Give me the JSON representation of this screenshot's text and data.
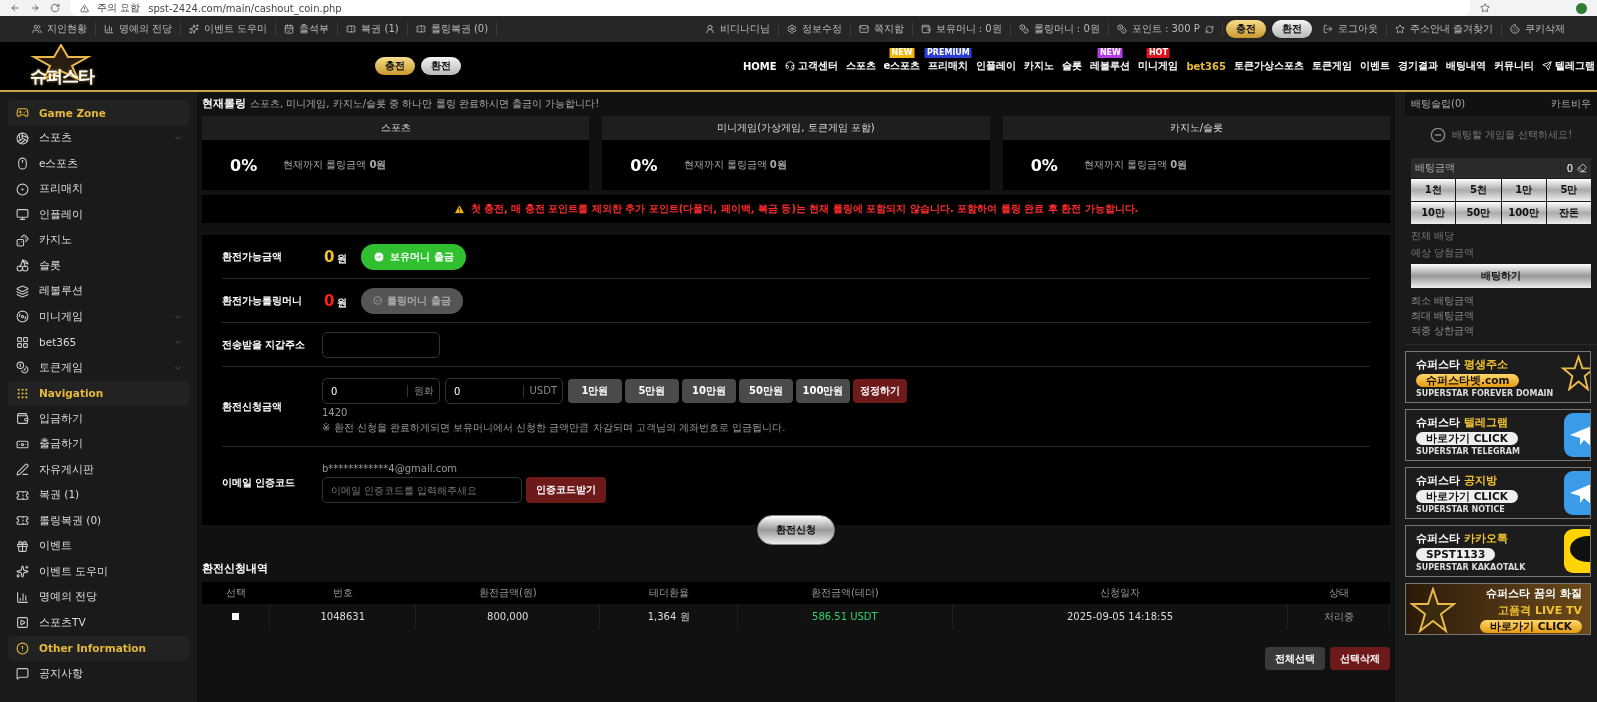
{
  "browser": {
    "security": "주의 요함",
    "url": "spst-2424.com/main/cashout_coin.php"
  },
  "util_left": [
    "지인현황",
    "명예의 전당",
    "이벤트 도우미",
    "출석부",
    "복권 (1)",
    "롤링복권 (0)"
  ],
  "util_right": [
    {
      "kind": "link",
      "label": "비디나디님"
    },
    {
      "kind": "link",
      "label": "정보수정"
    },
    {
      "kind": "link",
      "label": "쪽지함"
    },
    {
      "kind": "link",
      "label": "보유머니 : 0원"
    },
    {
      "kind": "link",
      "label": "롤링머니 : 0원"
    },
    {
      "kind": "link",
      "label": "포인트 : 300 P"
    },
    {
      "kind": "gold",
      "label": "충전"
    },
    {
      "kind": "silver",
      "label": "환전"
    },
    {
      "kind": "link",
      "label": "로그아웃"
    },
    {
      "kind": "link",
      "label": "주소안내 즐겨찾기"
    },
    {
      "kind": "link",
      "label": "쿠키삭제"
    }
  ],
  "logo": "슈퍼스타",
  "header_buttons": [
    {
      "kind": "gold",
      "label": "충전"
    },
    {
      "kind": "silver",
      "label": "환전"
    }
  ],
  "nav": [
    {
      "label": "HOME",
      "highlight": false
    },
    {
      "label": "고객센터",
      "highlight": false
    },
    {
      "label": "스포츠",
      "highlight": false
    },
    {
      "label": "e스포츠",
      "highlight": false,
      "badge": {
        "text": "NEW",
        "color": "#f2b705"
      }
    },
    {
      "label": "프리매치",
      "highlight": false,
      "badge": {
        "text": "PREMIUM",
        "color": "#2b3fd6"
      }
    },
    {
      "label": "인플레이",
      "highlight": false
    },
    {
      "label": "카지노",
      "highlight": false
    },
    {
      "label": "슬롯",
      "highlight": false
    },
    {
      "label": "레볼루션",
      "highlight": false,
      "badge": {
        "text": "NEW",
        "color": "#b23be6"
      }
    },
    {
      "label": "미니게임",
      "highlight": false,
      "badge": {
        "text": "HOT",
        "color": "#e0141e"
      }
    },
    {
      "label": "bet365",
      "highlight": true
    },
    {
      "label": "토큰가상스포츠",
      "highlight": false
    },
    {
      "label": "토큰게임",
      "highlight": false
    },
    {
      "label": "이벤트",
      "highlight": false
    },
    {
      "label": "경기결과",
      "highlight": false
    },
    {
      "label": "배팅내역",
      "highlight": false
    },
    {
      "label": "커뮤니티",
      "highlight": false
    },
    {
      "label": "텔레그램",
      "highlight": false
    }
  ],
  "sidebar": [
    {
      "kind": "section",
      "label": "Game Zone"
    },
    {
      "kind": "item",
      "label": "스포츠",
      "expandable": true
    },
    {
      "kind": "item",
      "label": "e스포츠",
      "expandable": false
    },
    {
      "kind": "item",
      "label": "프리매치",
      "expandable": false
    },
    {
      "kind": "item",
      "label": "인플레이",
      "expandable": false
    },
    {
      "kind": "item",
      "label": "카지노",
      "expandable": false
    },
    {
      "kind": "item",
      "label": "슬롯",
      "expandable": false
    },
    {
      "kind": "item",
      "label": "레볼루션",
      "expandable": false
    },
    {
      "kind": "item",
      "label": "미니게임",
      "expandable": true
    },
    {
      "kind": "item",
      "label": "bet365",
      "expandable": true
    },
    {
      "kind": "item",
      "label": "토큰게임",
      "expandable": true
    },
    {
      "kind": "section",
      "label": "Navigation"
    },
    {
      "kind": "item",
      "label": "입금하기",
      "expandable": false
    },
    {
      "kind": "item",
      "label": "출금하기",
      "expandable": false
    },
    {
      "kind": "item",
      "label": "자유게시판",
      "expandable": false
    },
    {
      "kind": "item",
      "label": "복권 (1)",
      "expandable": false
    },
    {
      "kind": "item",
      "label": "롤링복권 (0)",
      "expandable": false
    },
    {
      "kind": "item",
      "label": "이벤트",
      "expandable": false
    },
    {
      "kind": "item",
      "label": "이벤트 도우미",
      "expandable": false
    },
    {
      "kind": "item",
      "label": "명예의 전당",
      "expandable": false
    },
    {
      "kind": "item",
      "label": "스포츠TV",
      "expandable": false
    },
    {
      "kind": "section",
      "label": "Other Information"
    },
    {
      "kind": "item",
      "label": "공지사항",
      "expandable": false
    }
  ],
  "rolling": {
    "title": "현재롤링",
    "note": "스포츠, 미니게임, 카지노/슬롯 중 하나만 롤링 완료하시면 출금이 가능합니다!",
    "cards": [
      {
        "title": "스포츠",
        "percent": "0%",
        "caption": "현재까지 롤링금액 **0원**"
      },
      {
        "title": "미니게임(가상게임, 토큰게임 포함)",
        "percent": "0%",
        "caption": "현재까지 롤링금액 **0원**"
      },
      {
        "title": "카지노/슬롯",
        "percent": "0%",
        "caption": "현재까지 롤링금액 **0원**"
      }
    ],
    "warning": "첫 충전, 매 충전 포인트를 제외한 추가 포인트(다폴더, 페이백, 복금 등)는 현재 롤링에 포함되지 않습니다. 포함하여 롤링 완료 후 환전 가능합니다."
  },
  "form": {
    "available": {
      "label": "환전가능금액",
      "value": "0",
      "unit": "원",
      "button": {
        "label": "보유머니 출금",
        "disabled": false
      }
    },
    "rolling": {
      "label": "환전가능롤링머니",
      "value": "0",
      "unit": "원",
      "button": {
        "label": "롤링머니 출금",
        "disabled": true
      }
    },
    "wallet": {
      "label": "전송받을 지갑주소"
    },
    "request": {
      "label": "환전신청금액",
      "krw": {
        "value": "0",
        "unit": "원화"
      },
      "usdt": {
        "value": "0",
        "unit": "USDT"
      },
      "presets": [
        "1만원",
        "5만원",
        "10만원",
        "50만원",
        "100만원"
      ],
      "reset": "정정하기",
      "rate": "1420",
      "note": "※ 환전 신청을 완료하게되면 보유머니에서 신청한 금액만큼 차감되며 고객님의 계좌번호로 입금됩니다."
    },
    "email": {
      "label": "이메일 인증코드",
      "address": "b************4@gmail.com",
      "placeholder": "이메일 인증코드를 입력해주세요",
      "button": "인증코드받기"
    }
  },
  "submit": "환전신청",
  "history": {
    "title": "환전신청내역",
    "columns": [
      "선택",
      "번호",
      "환전금액(원)",
      "테더환율",
      "환전금액(테더)",
      "신청일자",
      "상태"
    ],
    "rows": [
      {
        "cells": [
          {
            "checked": false
          },
          "1048631",
          "800,000",
          "1,364 원",
          "586.51 USDT",
          "2025-09-05 14:18:55",
          "처리중"
        ]
      }
    ],
    "buttons": [
      {
        "kind": "gray",
        "label": "전체선택"
      },
      {
        "kind": "red",
        "label": "선택삭제"
      }
    ]
  },
  "betslip": {
    "title": "배팅슬립(0)",
    "clear": "카트비우",
    "empty": "배팅할 게임을 선택하세요!",
    "stake_label": "배팅금액",
    "stake": "0",
    "chips": [
      "1천",
      "5천",
      "1만",
      "5만",
      "10만",
      "50만",
      "100만",
      "잔돈"
    ],
    "info": [
      "전체 배당",
      "예상 당첨금액"
    ],
    "submit": "배팅하기",
    "limits": [
      "최소 배팅금액",
      "최대 배팅금액",
      "적중 상한금액"
    ]
  },
  "banners": [
    {
      "kind": "domain",
      "brand": "슈퍼스타",
      "title": "평생주소",
      "pill": "슈퍼스타벳.com",
      "caption": "SUPERSTAR FOREVER DOMAIN"
    },
    {
      "kind": "telegram",
      "brand": "슈퍼스타",
      "title": "텔레그램",
      "pill": "바로가기 CLICK",
      "caption": "SUPERSTAR TELEGRAM"
    },
    {
      "kind": "telegram",
      "brand": "슈퍼스타",
      "title": "공지방",
      "pill": "바로가기 CLICK",
      "caption": "SUPERSTAR NOTICE"
    },
    {
      "kind": "kakao",
      "brand": "슈퍼스타",
      "title": "카카오톡",
      "pill": "SPST1133",
      "caption": "SUPERSTAR KAKAOTALK"
    },
    {
      "kind": "tv",
      "brand": "슈퍼스타",
      "title": "꿈의 화질",
      "pill": "바로가기 CLICK",
      "caption": "고품격 LIVE TV"
    }
  ]
}
